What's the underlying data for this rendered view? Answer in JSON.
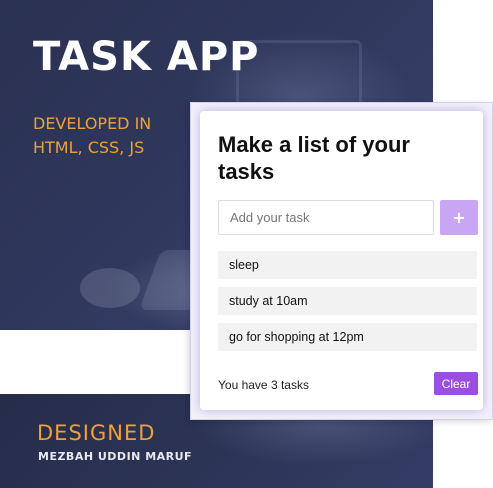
{
  "banner": {
    "title": "TASK APP",
    "subtitle": "DEVELOPED IN HTML, CSS, JS",
    "designed_label": "DESIGNED",
    "author": "MEZBAH UDDIN MARUF",
    "accent_color": "#f0a035",
    "background_color": "#2f375c"
  },
  "app": {
    "heading": "Make a list of your tasks",
    "input": {
      "placeholder": "Add your task",
      "value": ""
    },
    "add_button_label": "+",
    "tasks": [
      "sleep",
      "study at 10am",
      "go for shopping at 12pm"
    ],
    "footer_text": "You have 3 tasks",
    "clear_button_label": "Clear",
    "colors": {
      "add_button": "#c9a6f3",
      "clear_button": "#9b4fe0",
      "task_background": "#f2f2f2"
    }
  }
}
